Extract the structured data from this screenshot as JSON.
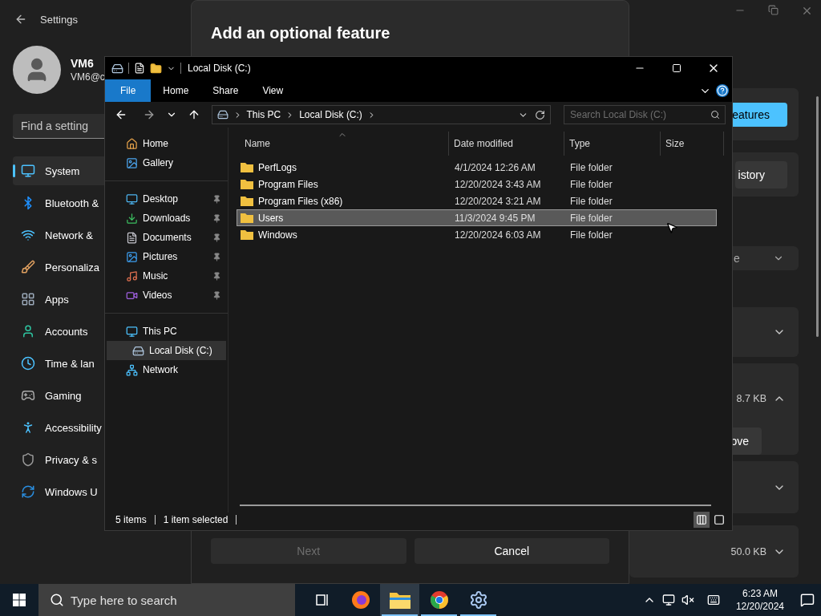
{
  "settings": {
    "title": "Settings",
    "user": {
      "name": "VM6",
      "email": "VM6@c"
    },
    "search": {
      "placeholder": "Find a setting"
    },
    "nav": [
      {
        "label": "System",
        "selected": true
      },
      {
        "label": "Bluetooth &",
        "selected": false
      },
      {
        "label": "Network &",
        "selected": false
      },
      {
        "label": "Personaliza",
        "selected": false
      },
      {
        "label": "Apps",
        "selected": false
      },
      {
        "label": "Accounts",
        "selected": false
      },
      {
        "label": "Time & lan",
        "selected": false
      },
      {
        "label": "Gaming",
        "selected": false
      },
      {
        "label": "Accessibility",
        "selected": false
      },
      {
        "label": "Privacy & s",
        "selected": false
      },
      {
        "label": "Windows U",
        "selected": false
      }
    ],
    "cards": [
      {
        "kind": "action",
        "button": "eatures",
        "primary": true
      },
      {
        "kind": "action",
        "button": "istory",
        "primary": false
      },
      {
        "kind": "dropdown",
        "value": "e"
      },
      {
        "kind": "feature",
        "expanded": false
      },
      {
        "kind": "feature",
        "size": "8.7 KB",
        "expanded": true,
        "button": "ove"
      },
      {
        "kind": "feature",
        "expanded": false
      },
      {
        "kind": "feature",
        "size": "50.0 KB",
        "expanded": false
      }
    ]
  },
  "dialog": {
    "title": "Add an optional feature",
    "buttons": [
      {
        "label": "Next",
        "disabled": true
      },
      {
        "label": "Cancel",
        "disabled": false
      }
    ]
  },
  "explorer": {
    "title": "Local Disk (C:)",
    "ribbon_tabs": [
      {
        "label": "File",
        "selected": true
      },
      {
        "label": "Home",
        "selected": false
      },
      {
        "label": "Share",
        "selected": false
      },
      {
        "label": "View",
        "selected": false
      }
    ],
    "breadcrumb": [
      "This PC",
      "Local Disk (C:)"
    ],
    "search": {
      "placeholder": "Search Local Disk (C:)"
    },
    "nav_groups": [
      [
        {
          "label": "Home",
          "pinned": false,
          "selected": false
        },
        {
          "label": "Gallery",
          "pinned": false,
          "selected": false
        }
      ],
      [
        {
          "label": "Desktop",
          "pinned": true,
          "selected": false
        },
        {
          "label": "Downloads",
          "pinned": true,
          "selected": false
        },
        {
          "label": "Documents",
          "pinned": true,
          "selected": false
        },
        {
          "label": "Pictures",
          "pinned": true,
          "selected": false
        },
        {
          "label": "Music",
          "pinned": true,
          "selected": false
        },
        {
          "label": "Videos",
          "pinned": true,
          "selected": false
        }
      ],
      [
        {
          "label": "This PC",
          "pinned": false,
          "selected": false,
          "children": [
            {
              "label": "Local Disk (C:)",
              "pinned": false,
              "selected": true
            }
          ]
        },
        {
          "label": "Network",
          "pinned": false,
          "selected": false
        }
      ]
    ],
    "columns": [
      "Name",
      "Date modified",
      "Type",
      "Size"
    ],
    "rows": [
      {
        "name": "PerfLogs",
        "date": "4/1/2024 12:26 AM",
        "type": "File folder",
        "selected": false
      },
      {
        "name": "Program Files",
        "date": "12/20/2024 3:43 AM",
        "type": "File folder",
        "selected": false
      },
      {
        "name": "Program Files (x86)",
        "date": "12/20/2024 3:21 AM",
        "type": "File folder",
        "selected": false
      },
      {
        "name": "Users",
        "date": "11/3/2024 9:45 PM",
        "type": "File folder",
        "selected": true
      },
      {
        "name": "Windows",
        "date": "12/20/2024 6:03 AM",
        "type": "File folder",
        "selected": false
      }
    ],
    "status": [
      "5 items",
      "1 item selected"
    ],
    "views": [
      {
        "selected": true
      },
      {
        "selected": false
      }
    ]
  },
  "taskbar": {
    "search": {
      "placeholder": "Type here to search"
    },
    "apps": [
      {
        "kind": "taskview",
        "running": false,
        "active": false
      },
      {
        "kind": "firefox",
        "running": false,
        "active": false
      },
      {
        "kind": "explorer",
        "running": true,
        "active": true
      },
      {
        "kind": "chrome",
        "running": true,
        "active": false
      },
      {
        "kind": "settings",
        "running": true,
        "active": false
      }
    ],
    "time": "6:23 AM",
    "date": "12/20/2024"
  }
}
